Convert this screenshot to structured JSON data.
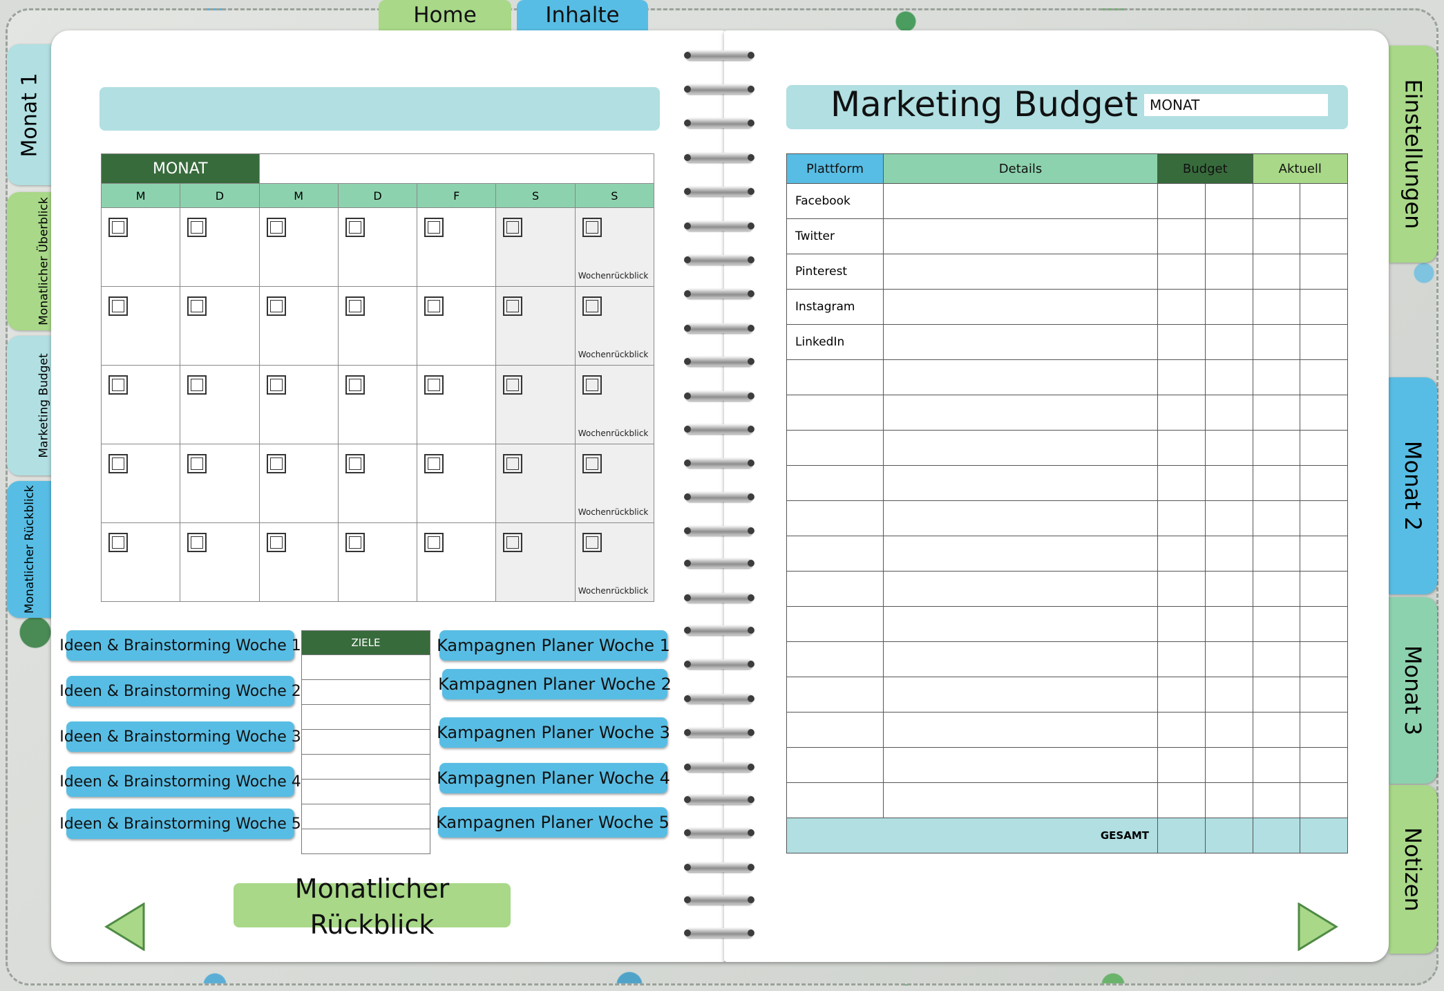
{
  "top_tabs": {
    "home": "Home",
    "inhalte": "Inhalte"
  },
  "left_tabs": [
    {
      "label": "Monat 1"
    },
    {
      "label": "Monatlicher Überblick"
    },
    {
      "label": "Marketing Budget"
    },
    {
      "label": "Monatlicher Rückblick"
    }
  ],
  "right_tabs": [
    {
      "label": "Einstellungen"
    },
    {
      "label": "Monat 2"
    },
    {
      "label": "Monat 3"
    },
    {
      "label": "Notizen"
    }
  ],
  "calendar": {
    "month_header": "MONAT",
    "days": [
      "M",
      "D",
      "M",
      "D",
      "F",
      "S",
      "S"
    ],
    "week_review_label": "Wochenrückblick"
  },
  "ideas_buttons": [
    "Ideen & Brainstorming Woche 1",
    "Ideen & Brainstorming Woche 2",
    "Ideen & Brainstorming Woche 3",
    "Ideen & Brainstorming Woche 4",
    "Ideen & Brainstorming Woche 5"
  ],
  "goals": {
    "header": "ZIELE"
  },
  "campaign_buttons": [
    "Kampagnen Planer Woche 1",
    "Kampagnen Planer Woche 2",
    "Kampagnen Planer Woche 3",
    "Kampagnen Planer Woche 4",
    "Kampagnen Planer Woche 5"
  ],
  "monthly_review_button": "Monatlicher Rückblick",
  "budget": {
    "title": "Marketing Budget",
    "month_field_value": "MONAT",
    "columns": [
      "Plattform",
      "Details",
      "Budget",
      "Aktuell"
    ],
    "platforms": [
      "Facebook",
      "Twitter",
      "Pinterest",
      "Instagram",
      "LinkedIn"
    ],
    "total_label": "GESAMT"
  },
  "colors": {
    "blue_tab": "#58bde4",
    "green_tab": "#a8d888",
    "light_blue": "#b1dfe2",
    "dark_green": "#386b3c",
    "mint": "#8dd2ae"
  }
}
